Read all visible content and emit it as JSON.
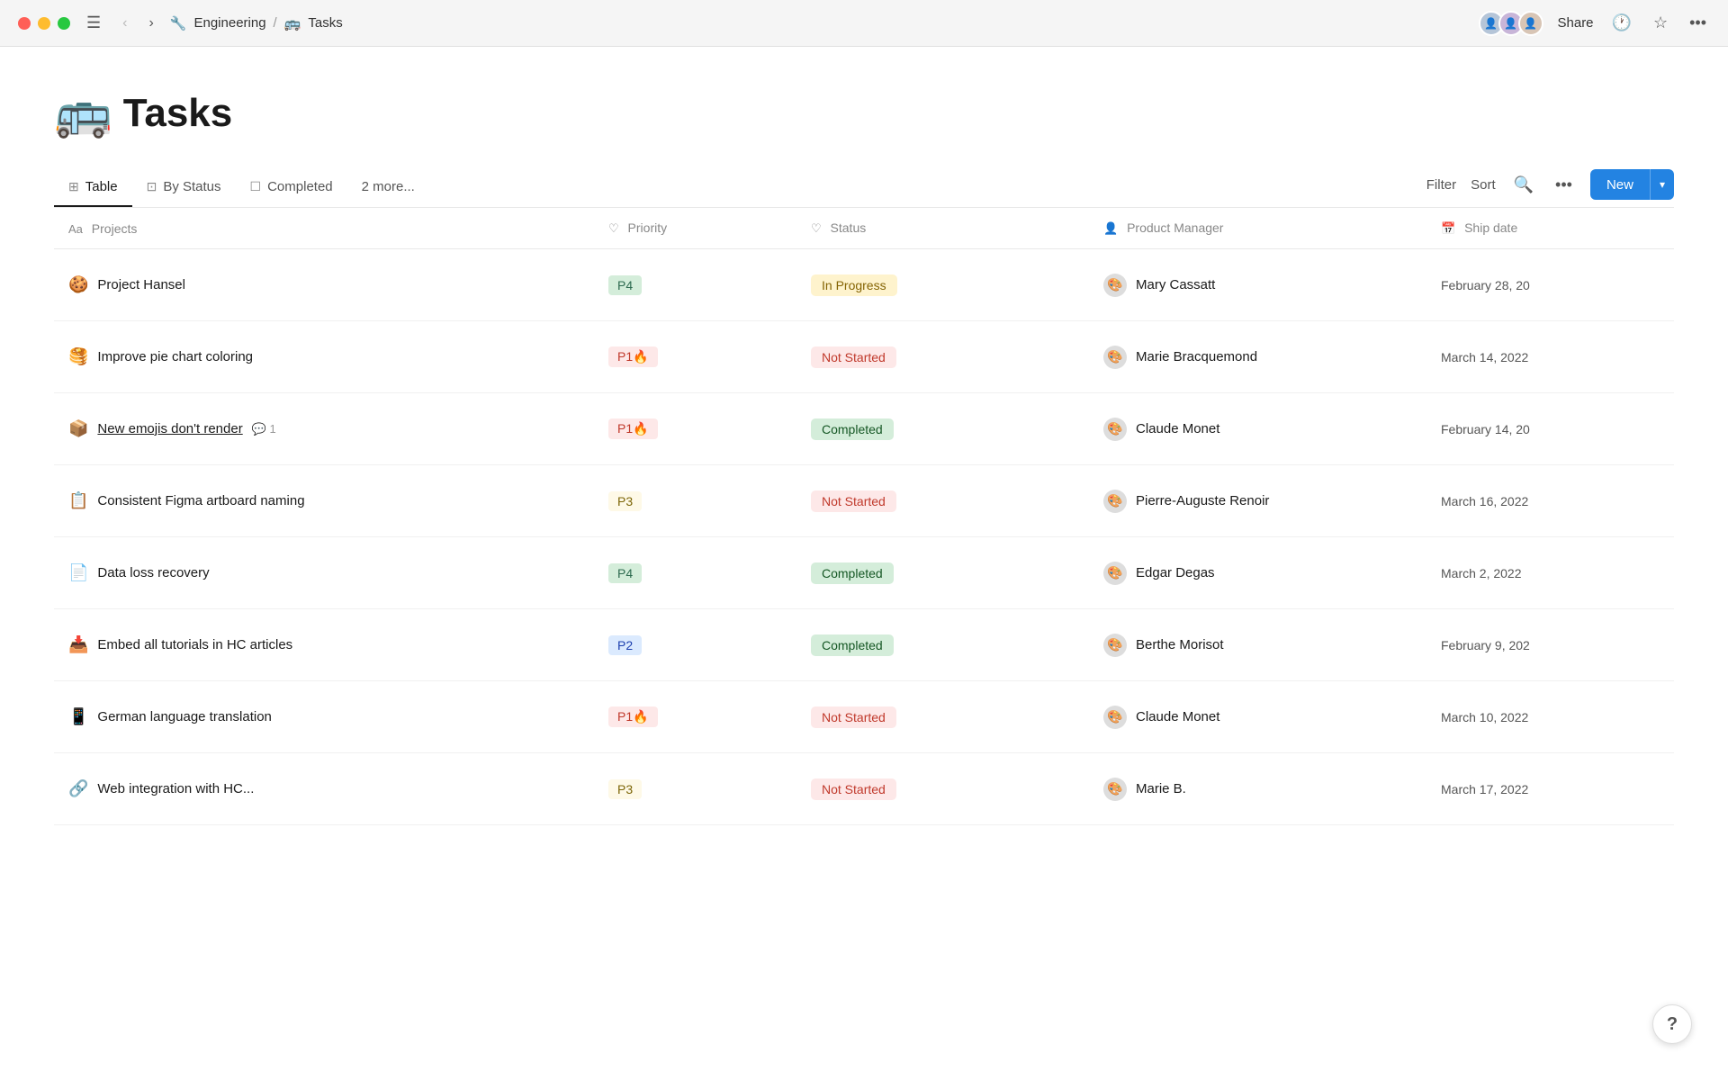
{
  "titlebar": {
    "breadcrumb": {
      "workspace_emoji": "🔧",
      "workspace_name": "Engineering",
      "separator": "/",
      "page_emoji": "🚌",
      "page_name": "Tasks"
    },
    "share_label": "Share",
    "avatars": [
      "👤",
      "👤",
      "👤"
    ]
  },
  "page": {
    "title_emoji": "🚌",
    "title": "Tasks"
  },
  "tabs": [
    {
      "id": "table",
      "icon": "⊞",
      "label": "Table",
      "active": true
    },
    {
      "id": "by-status",
      "icon": "⊡",
      "label": "By Status",
      "active": false
    },
    {
      "id": "completed",
      "icon": "☐",
      "label": "Completed",
      "active": false
    },
    {
      "id": "more",
      "icon": "",
      "label": "2 more...",
      "active": false
    }
  ],
  "tabs_actions": {
    "filter_label": "Filter",
    "sort_label": "Sort",
    "new_label": "New"
  },
  "table": {
    "columns": [
      {
        "id": "projects",
        "icon": "Aa",
        "label": "Projects"
      },
      {
        "id": "priority",
        "icon": "♡",
        "label": "Priority"
      },
      {
        "id": "status",
        "icon": "♡",
        "label": "Status"
      },
      {
        "id": "manager",
        "icon": "👤",
        "label": "Product Manager"
      },
      {
        "id": "shipdate",
        "icon": "📅",
        "label": "Ship date"
      }
    ],
    "rows": [
      {
        "id": 1,
        "project_emoji": "🍪",
        "project_name": "Project Hansel",
        "project_underline": false,
        "comment_count": 0,
        "priority": "P4",
        "priority_class": "p4",
        "status": "In Progress",
        "status_class": "inprogress",
        "manager_avatar": "🎨",
        "manager_name": "Mary Cassatt",
        "ship_date": "February 28, 20"
      },
      {
        "id": 2,
        "project_emoji": "🥞",
        "project_name": "Improve pie chart coloring",
        "project_underline": false,
        "comment_count": 0,
        "priority": "P1🔥",
        "priority_class": "p1",
        "status": "Not Started",
        "status_class": "notstarted",
        "manager_avatar": "🎨",
        "manager_name": "Marie Bracquemond",
        "ship_date": "March 14, 2022"
      },
      {
        "id": 3,
        "project_emoji": "📦",
        "project_name": "New emojis don't render",
        "project_underline": true,
        "comment_count": 1,
        "priority": "P1🔥",
        "priority_class": "p1",
        "status": "Completed",
        "status_class": "completed",
        "manager_avatar": "🎨",
        "manager_name": "Claude Monet",
        "ship_date": "February 14, 20"
      },
      {
        "id": 4,
        "project_emoji": "📋",
        "project_name": "Consistent Figma artboard naming",
        "project_underline": false,
        "comment_count": 0,
        "priority": "P3",
        "priority_class": "p3",
        "status": "Not Started",
        "status_class": "notstarted",
        "manager_avatar": "🎨",
        "manager_name": "Pierre-Auguste Renoir",
        "ship_date": "March 16, 2022"
      },
      {
        "id": 5,
        "project_emoji": "📄",
        "project_name": "Data loss recovery",
        "project_underline": false,
        "comment_count": 0,
        "priority": "P4",
        "priority_class": "p4",
        "status": "Completed",
        "status_class": "completed",
        "manager_avatar": "🎨",
        "manager_name": "Edgar Degas",
        "ship_date": "March 2, 2022"
      },
      {
        "id": 6,
        "project_emoji": "📥",
        "project_name": "Embed all tutorials in HC articles",
        "project_underline": false,
        "comment_count": 0,
        "priority": "P2",
        "priority_class": "p2",
        "status": "Completed",
        "status_class": "completed",
        "manager_avatar": "🎨",
        "manager_name": "Berthe Morisot",
        "ship_date": "February 9, 202"
      },
      {
        "id": 7,
        "project_emoji": "📱",
        "project_name": "German language translation",
        "project_underline": false,
        "comment_count": 0,
        "priority": "P1🔥",
        "priority_class": "p1",
        "status": "Not Started",
        "status_class": "notstarted",
        "manager_avatar": "🎨",
        "manager_name": "Claude Monet",
        "ship_date": "March 10, 2022"
      },
      {
        "id": 8,
        "project_emoji": "🔗",
        "project_name": "Web integration with HC...",
        "project_underline": false,
        "comment_count": 0,
        "priority": "P3",
        "priority_class": "p3",
        "status": "Not Started",
        "status_class": "notstarted",
        "manager_avatar": "🎨",
        "manager_name": "Marie B.",
        "ship_date": "March 17, 2022"
      }
    ]
  },
  "help_label": "?"
}
